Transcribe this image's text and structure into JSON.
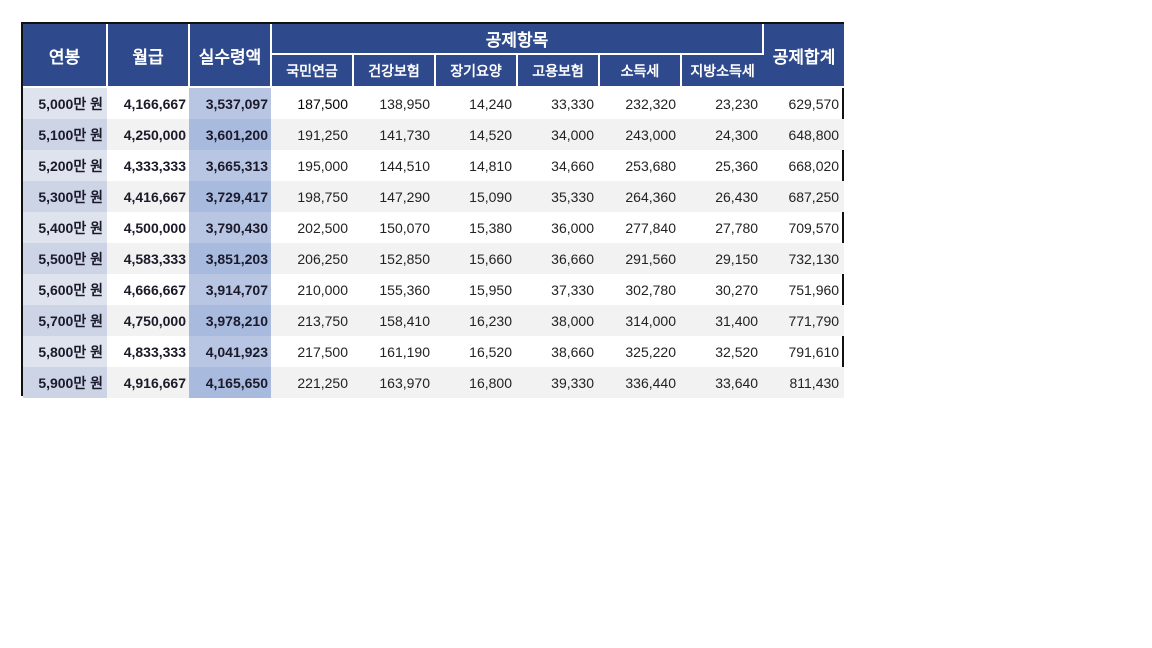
{
  "header": {
    "annual": "연봉",
    "monthly": "월급",
    "net": "실수령액",
    "deductions_group": "공제항목",
    "total": "공제합계",
    "deduction_columns": [
      "국민연금",
      "건강보험",
      "장기요양",
      "고용보험",
      "소득세",
      "지방소득세"
    ]
  },
  "rows": [
    {
      "annual": "5,000만 원",
      "monthly": "4,166,667",
      "net": "3,537,097",
      "d": [
        "187,500",
        "138,950",
        "14,240",
        "33,330",
        "232,320",
        "23,230"
      ],
      "total": "629,570"
    },
    {
      "annual": "5,100만 원",
      "monthly": "4,250,000",
      "net": "3,601,200",
      "d": [
        "191,250",
        "141,730",
        "14,520",
        "34,000",
        "243,000",
        "24,300"
      ],
      "total": "648,800"
    },
    {
      "annual": "5,200만 원",
      "monthly": "4,333,333",
      "net": "3,665,313",
      "d": [
        "195,000",
        "144,510",
        "14,810",
        "34,660",
        "253,680",
        "25,360"
      ],
      "total": "668,020"
    },
    {
      "annual": "5,300만 원",
      "monthly": "4,416,667",
      "net": "3,729,417",
      "d": [
        "198,750",
        "147,290",
        "15,090",
        "35,330",
        "264,360",
        "26,430"
      ],
      "total": "687,250"
    },
    {
      "annual": "5,400만 원",
      "monthly": "4,500,000",
      "net": "3,790,430",
      "d": [
        "202,500",
        "150,070",
        "15,380",
        "36,000",
        "277,840",
        "27,780"
      ],
      "total": "709,570"
    },
    {
      "annual": "5,500만 원",
      "monthly": "4,583,333",
      "net": "3,851,203",
      "d": [
        "206,250",
        "152,850",
        "15,660",
        "36,660",
        "291,560",
        "29,150"
      ],
      "total": "732,130"
    },
    {
      "annual": "5,600만 원",
      "monthly": "4,666,667",
      "net": "3,914,707",
      "d": [
        "210,000",
        "155,360",
        "15,950",
        "37,330",
        "302,780",
        "30,270"
      ],
      "total": "751,960"
    },
    {
      "annual": "5,700만 원",
      "monthly": "4,750,000",
      "net": "3,978,210",
      "d": [
        "213,750",
        "158,410",
        "16,230",
        "38,000",
        "314,000",
        "31,400"
      ],
      "total": "771,790"
    },
    {
      "annual": "5,800만 원",
      "monthly": "4,833,333",
      "net": "4,041,923",
      "d": [
        "217,500",
        "161,190",
        "16,520",
        "38,660",
        "325,220",
        "32,520"
      ],
      "total": "791,610"
    },
    {
      "annual": "5,900만 원",
      "monthly": "4,916,667",
      "net": "4,165,650",
      "d": [
        "221,250",
        "163,970",
        "16,800",
        "39,330",
        "336,440",
        "33,640"
      ],
      "total": "811,430"
    }
  ],
  "colors": {
    "header_bg": "#2e4a8c",
    "annual_bg": "#dfe3ee",
    "net_bg": "#b8c6e3",
    "stripe_bg": "#f2f2f2"
  }
}
